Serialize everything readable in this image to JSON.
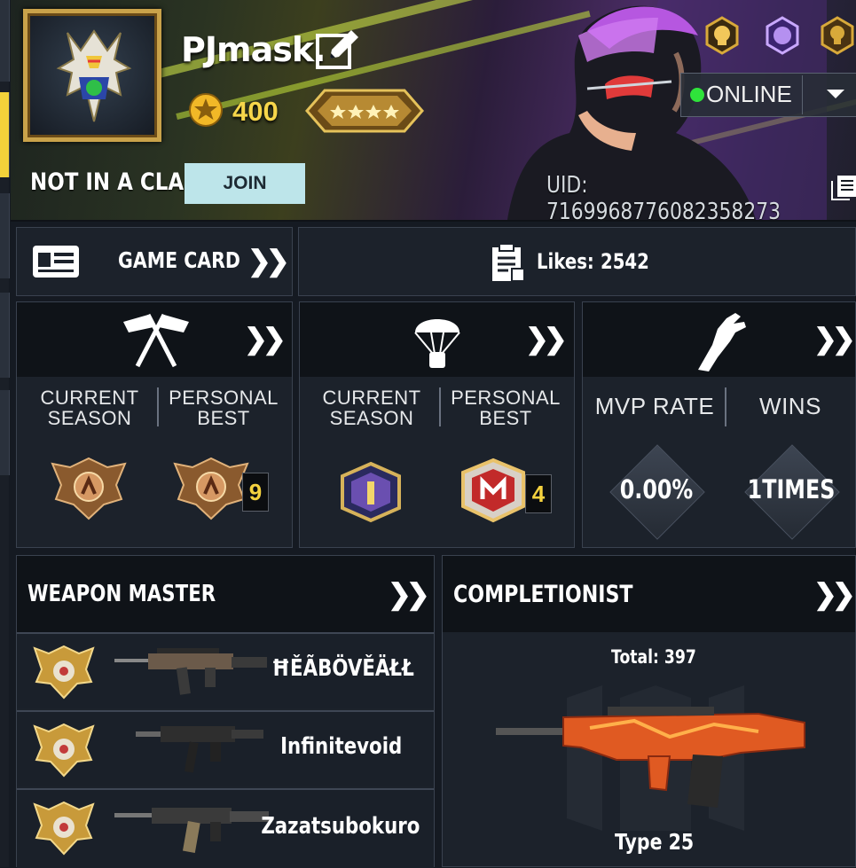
{
  "profile": {
    "name": "PJmask.",
    "points": "400",
    "clan_status": "NOT IN A CLAN",
    "join_label": "JOIN",
    "uid": "UID: 7169968776082358273",
    "status": "ONLINE"
  },
  "game_card": {
    "label": "GAME CARD"
  },
  "likes": {
    "label": "Likes:",
    "count": "2542"
  },
  "multiplayer": {
    "current": "CURRENT\nSEASON",
    "best": "PERSONAL\nBEST",
    "best_count": "9"
  },
  "battle_royale": {
    "current": "CURRENT\nSEASON",
    "best": "PERSONAL\nBEST",
    "best_count": "4"
  },
  "combat": {
    "mvp_label": "MVP RATE",
    "wins_label": "WINS",
    "mvp_value": "0.00%",
    "wins_value": "1TIMES"
  },
  "weapon_master": {
    "title": "WEAPON MASTER",
    "rows": [
      {
        "name": "ĦĚÃBÖVĚÄŁŁ"
      },
      {
        "name": "Infinitevoid"
      },
      {
        "name": "Zazatsubokuro"
      }
    ]
  },
  "completionist": {
    "title": "COMPLETIONIST",
    "total": "Total: 397",
    "weapon": "Type 25"
  },
  "colors": {
    "accent_gold": "#f6d64a",
    "online_green": "#2fe33b",
    "join_bg": "#bde5ea"
  }
}
